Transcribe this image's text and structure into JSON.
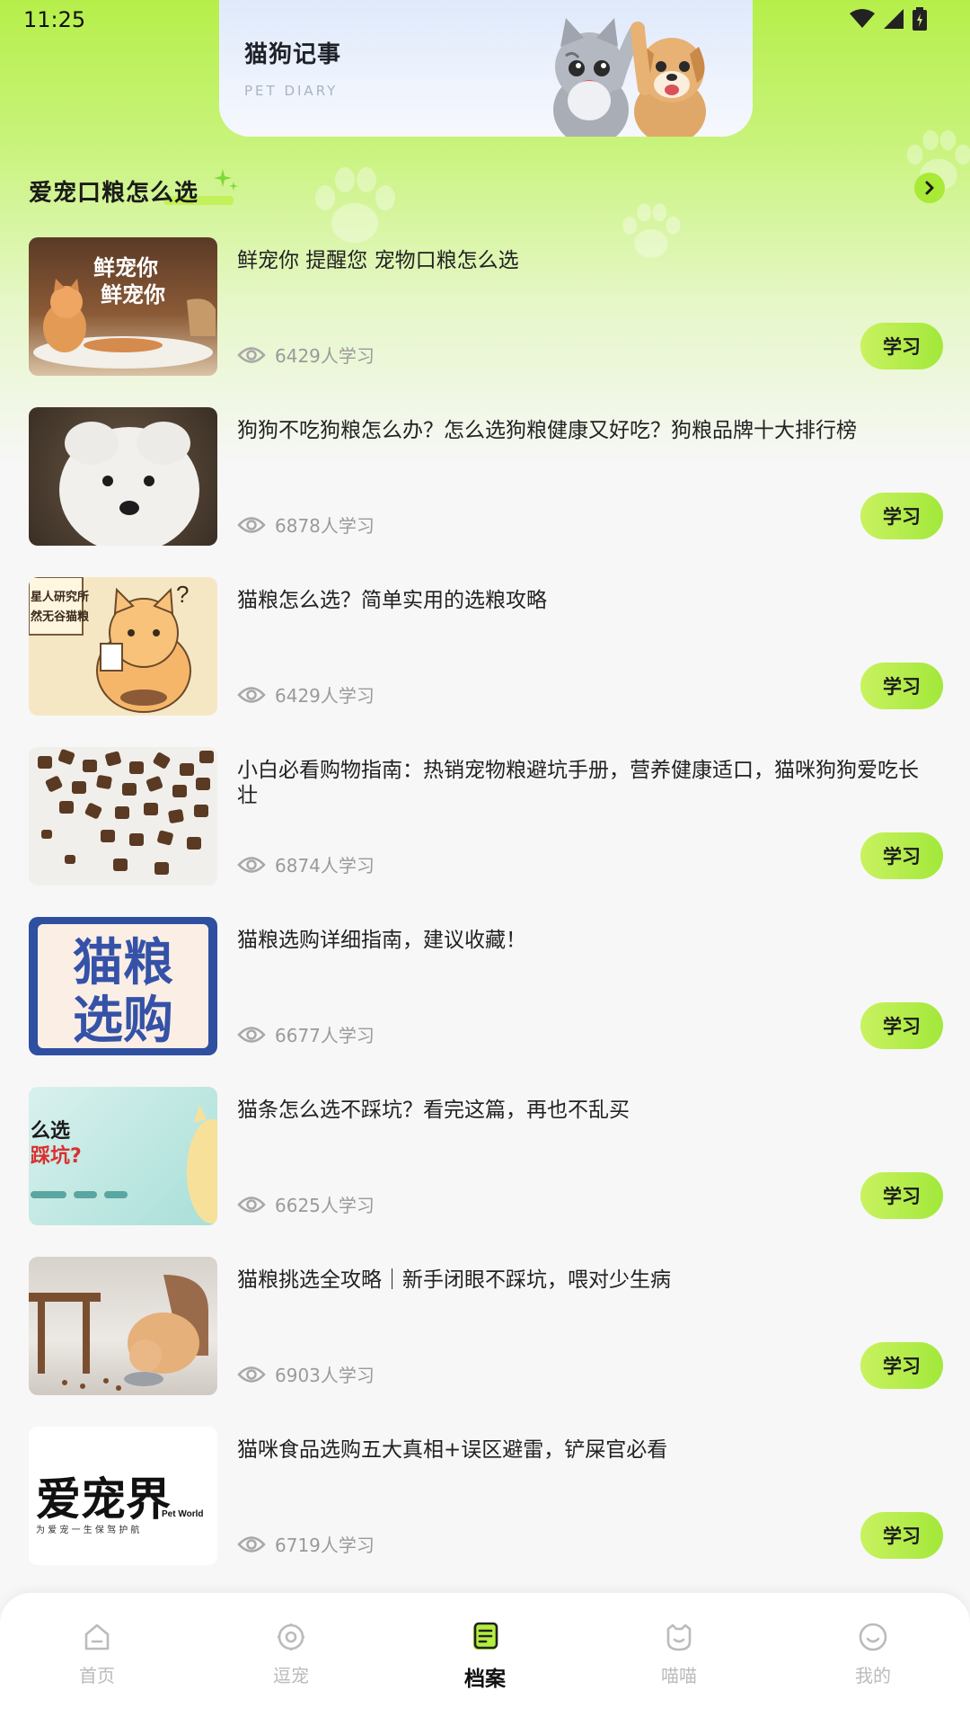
{
  "status_bar": {
    "time": "11:25"
  },
  "banner": {
    "title": "猫狗记事",
    "subtitle": "PET DIARY"
  },
  "section": {
    "title": "爱宠口粮怎么选"
  },
  "articles": [
    {
      "title": "鲜宠你 提醒您 宠物口粮怎么选",
      "views": "6429人学习",
      "button": "学习",
      "thumb_text": [
        "鲜宠你",
        "鲜宠你"
      ]
    },
    {
      "title": "狗狗不吃狗粮怎么办？怎么选狗粮健康又好吃？狗粮品牌十大排行榜",
      "views": "6878人学习",
      "button": "学习"
    },
    {
      "title": "猫粮怎么选？简单实用的选粮攻略",
      "views": "6429人学习",
      "button": "学习",
      "thumb_text": [
        "星人研究所",
        "然无谷猫粮"
      ]
    },
    {
      "title": "小白必看购物指南：热销宠物粮避坑手册，营养健康适口，猫咪狗狗爱吃长壮",
      "views": "6874人学习",
      "button": "学习"
    },
    {
      "title": "猫粮选购详细指南，建议收藏！",
      "views": "6677人学习",
      "button": "学习",
      "thumb_text": [
        "猫粮",
        "选购"
      ]
    },
    {
      "title": "猫条怎么选不踩坑？看完这篇，再也不乱买",
      "views": "6625人学习",
      "button": "学习",
      "thumb_text": [
        "么选",
        "踩坑?"
      ]
    },
    {
      "title": "猫粮挑选全攻略｜新手闭眼不踩坑，喂对少生病",
      "views": "6903人学习",
      "button": "学习"
    },
    {
      "title": "猫咪食品选购五大真相+误区避雷，铲屎官必看",
      "views": "6719人学习",
      "button": "学习",
      "thumb_text": [
        "爱宠界",
        "Pet World",
        "为 爱 宠 一 生 保 驾 护 航"
      ]
    }
  ],
  "tabbar": {
    "items": [
      {
        "label": "首页",
        "icon": "home-icon"
      },
      {
        "label": "逗宠",
        "icon": "play-icon"
      },
      {
        "label": "档案",
        "icon": "archive-icon",
        "active": true
      },
      {
        "label": "喵喵",
        "icon": "cat-icon"
      },
      {
        "label": "我的",
        "icon": "profile-icon"
      }
    ]
  },
  "colors": {
    "accent": "#a8ea36",
    "accent_light": "#c9f260",
    "muted": "#9a9a9a"
  }
}
